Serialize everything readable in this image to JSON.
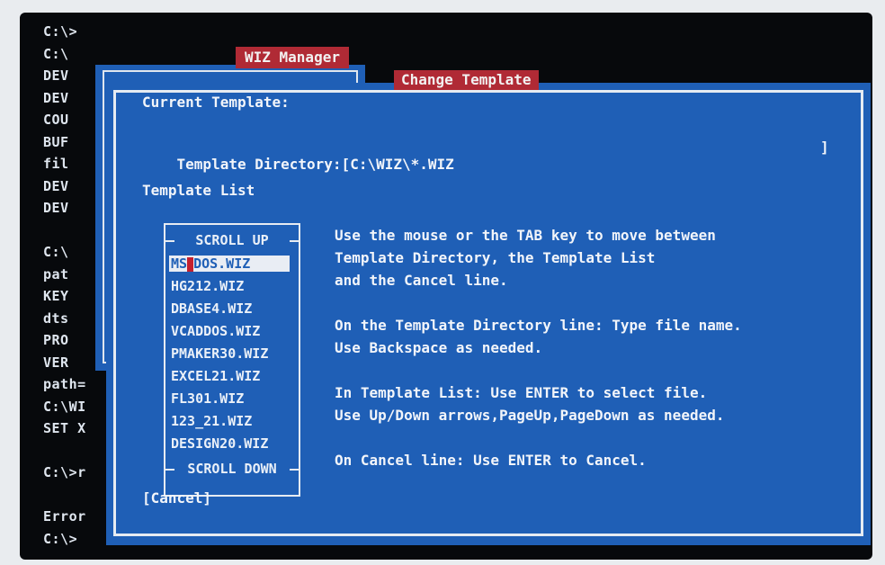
{
  "dos_prompt_lines": [
    "C:\\>",
    "C:\\",
    "DEV",
    "DEV",
    "COU",
    "BUF",
    "fil",
    "DEV",
    "DEV",
    "",
    "C:\\",
    "pat",
    "KEY",
    "dts",
    "PRO",
    "VER",
    "path=",
    "C:\\WI",
    "SET X",
    "",
    "C:\\>r",
    "",
    "Error",
    "C:\\>"
  ],
  "wiz_manager": {
    "title": "WIZ Manager"
  },
  "dialog": {
    "title": "Change Template",
    "current_template_label": "Current Template:",
    "template_directory_label": "Template Directory:[",
    "template_directory_value": "C:\\WIZ\\*.WIZ",
    "template_directory_close": "]",
    "template_list_label": "Template List",
    "scroll_up": "SCROLL UP",
    "scroll_down": "SCROLL DOWN",
    "template_items": [
      "MS-DOS.WIZ",
      "HG212.WIZ",
      "DBASE4.WIZ",
      "VCADDOS.WIZ",
      "PMAKER30.WIZ",
      "EXCEL21.WIZ",
      "FL301.WIZ",
      "123_21.WIZ",
      "DESIGN20.WIZ"
    ],
    "selected_index": 0,
    "cancel_label": "[Cancel]",
    "help_lines": [
      "Use the mouse or the TAB key to move between",
      "Template Directory, the Template List",
      "and the Cancel line.",
      "",
      "On the Template Directory line: Type file name.",
      "Use Backspace as needed.",
      "",
      "In Template List: Use ENTER to select file.",
      "Use Up/Down arrows,PageUp,PageDown as needed.",
      "",
      "On Cancel line: Use ENTER to Cancel."
    ]
  },
  "colors": {
    "dialog_bg": "#1f5fb6",
    "title_bg": "#b02a35",
    "screen_bg": "#07090c",
    "text": "#f2f5fa"
  }
}
